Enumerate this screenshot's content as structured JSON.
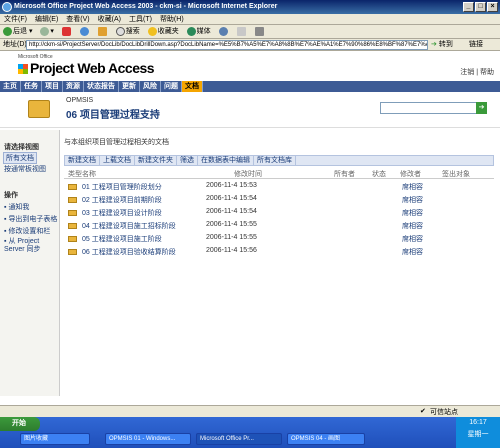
{
  "window": {
    "title": "Microsoft Office Project Web Access 2003 - ckm-si - Microsoft Internet Explorer"
  },
  "menubar": {
    "items": [
      "文件(F)",
      "编辑(E)",
      "查看(V)",
      "收藏(A)",
      "工具(T)",
      "帮助(H)"
    ]
  },
  "toolbar": {
    "back": "后退",
    "search": "搜索",
    "favorites": "收藏夹",
    "media": "媒体"
  },
  "address": {
    "label": "地址(D)",
    "url": "http://ckm-si/ProjectServer/DocLib/DocLibDrillDown.asp?DocLibName=%E5%B7%A5%E7%A8%8B%E7%AE%A1%E7%90%86%E8%BF%87%E7%A8%8B%E6%96%87%E6%A1%A3",
    "go": "转到",
    "links": "链接"
  },
  "pwa": {
    "ms_office": "Microsoft Office",
    "product": "Project Web Access",
    "links": "注销 | 帮助"
  },
  "nav": {
    "items": [
      "主页",
      "任务",
      "项目",
      "资源",
      "状态报告",
      "更新",
      "风险",
      "问题",
      "文档"
    ],
    "active_index": 8
  },
  "page": {
    "site": "OPMSIS",
    "title": "06 项目管理过程支持",
    "description": "与本组织项目管理过程相关的文档"
  },
  "leftnav": {
    "view_header": "请选择视图",
    "view_items": [
      "所有文档",
      "按通常板视图"
    ],
    "actions_header": "操作",
    "actions": [
      "通知我",
      "导出到电子表格",
      "修改设置和栏",
      "从 Project Server 同步"
    ]
  },
  "doc_toolbar": [
    "新建文档",
    "上载文档",
    "新建文件夹",
    "筛选",
    "在数据表中编辑",
    "所有文档库"
  ],
  "table": {
    "headers": [
      "类型",
      "名称",
      "修改时间",
      "所有者",
      "状态",
      "修改者",
      "签出对象"
    ],
    "rows": [
      {
        "name": "01 工程项目管理阶段划分",
        "date": "2006-11-4 15:53",
        "modifier": "席相容"
      },
      {
        "name": "02 工程建设项目前期阶段",
        "date": "2006-11-4 15:54",
        "modifier": "席相容"
      },
      {
        "name": "03 工程建设项目设计阶段",
        "date": "2006-11-4 15:54",
        "modifier": "席相容"
      },
      {
        "name": "04 工程建设项目施工招标阶段",
        "date": "2006-11-4 15:55",
        "modifier": "席相容"
      },
      {
        "name": "05 工程建设项目施工阶段",
        "date": "2006-11-4 15:55",
        "modifier": "席相容"
      },
      {
        "name": "06 工程建设项目验收结算阶段",
        "date": "2006-11-4 15:56",
        "modifier": "席相容"
      }
    ]
  },
  "status": {
    "zone": "可信站点"
  },
  "taskbar": {
    "start": "开始",
    "tasks": [
      "图片收藏",
      "OPMSIS 01 - Windows...",
      "Microsoft Office Pr...",
      "OPMSIS 04 - 画图"
    ],
    "clock": "16:17",
    "day": "星期一"
  }
}
